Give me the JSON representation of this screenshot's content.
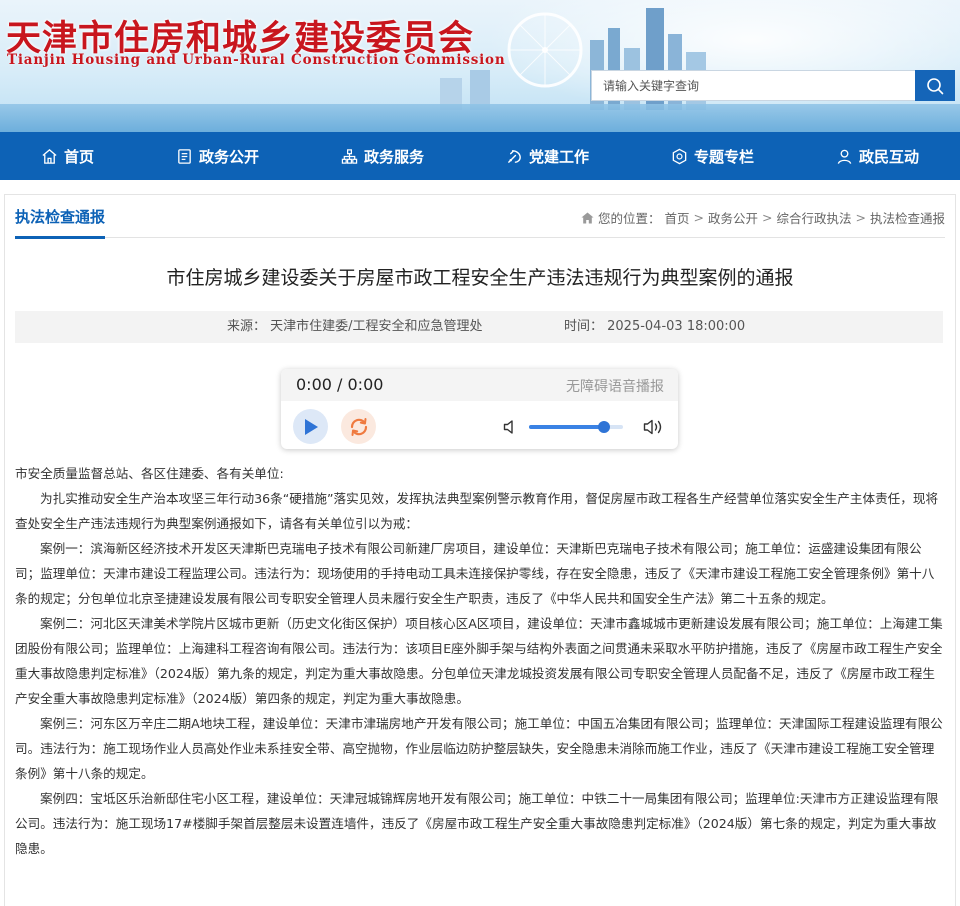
{
  "header": {
    "title": "天津市住房和城乡建设委员会",
    "subtitle": "Tianjin Housing and Urban-Rural Construction Commission",
    "search_placeholder": "请输入关键字查询"
  },
  "nav": {
    "items": [
      {
        "label": "首页",
        "icon": "home-icon"
      },
      {
        "label": "政务公开",
        "icon": "document-icon"
      },
      {
        "label": "政务服务",
        "icon": "org-chart-icon"
      },
      {
        "label": "党建工作",
        "icon": "party-icon"
      },
      {
        "label": "专题专栏",
        "icon": "badge-icon"
      },
      {
        "label": "政民互动",
        "icon": "person-icon"
      }
    ]
  },
  "section": {
    "tab": "执法检查通报"
  },
  "breadcrumb": {
    "prefix": "您的位置：",
    "items": [
      "首页",
      "政务公开",
      "综合行政执法",
      "执法检查通报"
    ],
    "separator": ">"
  },
  "article": {
    "title": "市住房城乡建设委关于房屋市政工程安全生产违法违规行为典型案例的通报",
    "source": "来源：  天津市住建委/工程安全和应急管理处",
    "time": "时间：  2025-04-03 18:00:00",
    "paragraphs": [
      "市安全质量监督总站、各区住建委、各有关单位:",
      "为扎实推动安全生产治本攻坚三年行动36条“硬措施”落实见效，发挥执法典型案例警示教育作用，督促房屋市政工程各生产经营单位落实安全生产主体责任，现将查处安全生产违法违规行为典型案例通报如下，请各有关单位引以为戒：",
      "案例一：滨海新区经济技术开发区天津斯巴克瑞电子技术有限公司新建厂房项目，建设单位：天津斯巴克瑞电子技术有限公司；施工单位：运盛建设集团有限公司；监理单位：天津市建设工程监理公司。违法行为：现场使用的手持电动工具未连接保护零线，存在安全隐患，违反了《天津市建设工程施工安全管理条例》第十八条的规定；分包单位北京圣捷建设发展有限公司专职安全管理人员未履行安全生产职责，违反了《中华人民共和国安全生产法》第二十五条的规定。",
      "案例二：河北区天津美术学院片区城市更新（历史文化街区保护）项目核心区A区项目，建设单位：天津市鑫城城市更新建设发展有限公司；施工单位：上海建工集团股份有限公司；监理单位：上海建科工程咨询有限公司。违法行为：该项目E座外脚手架与结构外表面之间贯通未采取水平防护措施，违反了《房屋市政工程生产安全重大事故隐患判定标准》（2024版）第九条的规定，判定为重大事故隐患。分包单位天津龙城投资发展有限公司专职安全管理人员配备不足，违反了《房屋市政工程生产安全重大事故隐患判定标准》（2024版）第四条的规定，判定为重大事故隐患。",
      "案例三：河东区万辛庄二期A地块工程，建设单位：天津市津瑞房地产开发有限公司；施工单位：中国五冶集团有限公司；监理单位：天津国际工程建设监理有限公司。违法行为：施工现场作业人员高处作业未系挂安全带、高空抛物，作业层临边防护整层缺失，安全隐患未消除而施工作业，违反了《天津市建设工程施工安全管理条例》第十八条的规定。",
      "案例四：宝坻区乐治新邸住宅小区工程，建设单位：天津冠城锦辉房地开发有限公司；施工单位：中铁二十一局集团有限公司；监理单位:天津市方正建设监理有限公司。违法行为：施工现场17#楼脚手架首层整层未设置连墙件，违反了《房屋市政工程生产安全重大事故隐患判定标准》（2024版）第七条的规定，判定为重大事故隐患。"
    ]
  },
  "player": {
    "time": "0:00 / 0:00",
    "label": "无障碍语音播报",
    "volume": 0.8
  },
  "colors": {
    "brand_red": "#c8161e",
    "nav_blue": "#0d62b6",
    "search_blue": "#1565b8"
  }
}
